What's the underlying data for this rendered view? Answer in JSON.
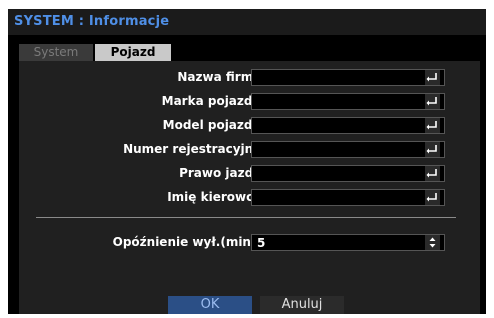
{
  "window": {
    "title": "SYSTEM : Informacje"
  },
  "tabs": [
    {
      "label": "System",
      "active": false
    },
    {
      "label": "Pojazd",
      "active": true
    }
  ],
  "fields": [
    {
      "label": "Nazwa firmy :",
      "value": ""
    },
    {
      "label": "Marka pojazdu :",
      "value": ""
    },
    {
      "label": "Model pojazdu :",
      "value": ""
    },
    {
      "label": "Numer rejestracyjny :",
      "value": ""
    },
    {
      "label": "Prawo jazdy :",
      "value": ""
    },
    {
      "label": "Imię kierowcy :",
      "value": ""
    }
  ],
  "delay": {
    "label": "Opóźnienie wył.(min.) :",
    "value": "5"
  },
  "buttons": {
    "ok": "OK",
    "cancel": "Anuluj"
  },
  "icons": {
    "enter": "enter-return-icon",
    "spinner": "up-down-spinner-icon"
  },
  "colors": {
    "title_text": "#4f8fe6",
    "ok_bg": "#2b4f86",
    "panel_bg": "#202020"
  }
}
